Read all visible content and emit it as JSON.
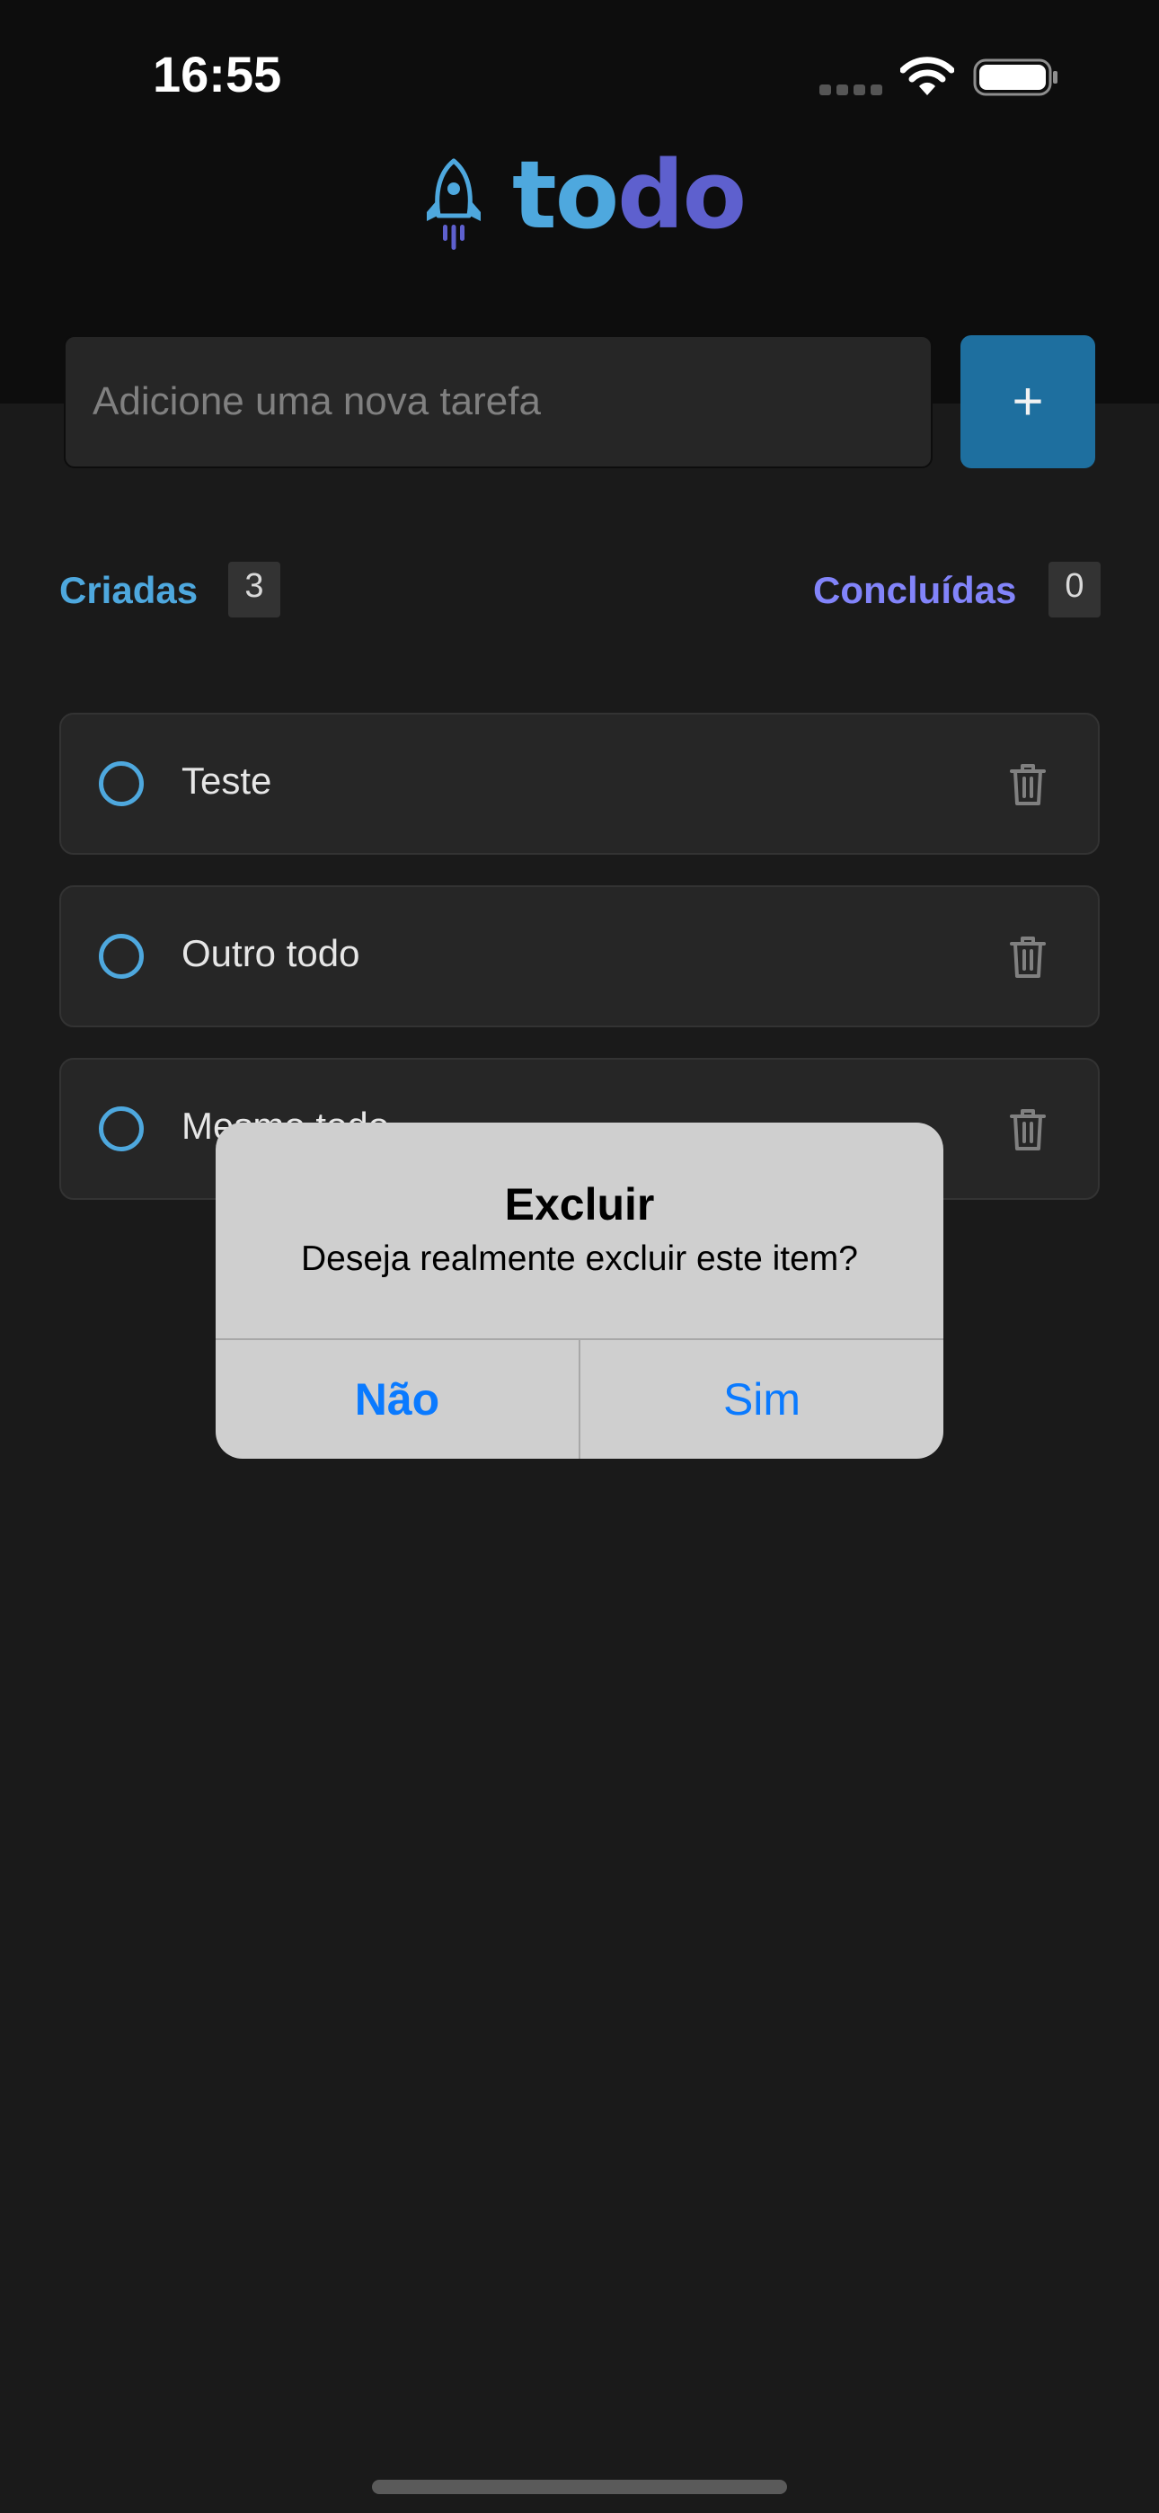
{
  "status_bar": {
    "time": "16:55"
  },
  "logo": {
    "text_part1": "to",
    "text_part2": "do"
  },
  "new_task": {
    "placeholder": "Adicione uma nova tarefa",
    "add_button_label": "+"
  },
  "counters": {
    "created": {
      "label": "Criadas",
      "count": "3"
    },
    "done": {
      "label": "Concluídas",
      "count": "0"
    }
  },
  "tasks": [
    {
      "text": "Teste"
    },
    {
      "text": "Outro todo"
    },
    {
      "text": "Mesmo todo"
    }
  ],
  "alert": {
    "title": "Excluir",
    "message": "Deseja realmente excluir este item?",
    "no_label": "Não",
    "yes_label": "Sim"
  },
  "colors": {
    "blue": "#4ea8de",
    "purple": "#5e60ce",
    "button_blue": "#1e6f9f",
    "header_bg": "#0d0d0d",
    "body_bg": "#1a1a1a",
    "card_bg": "#262626",
    "ios_blue": "#0a7aff"
  }
}
